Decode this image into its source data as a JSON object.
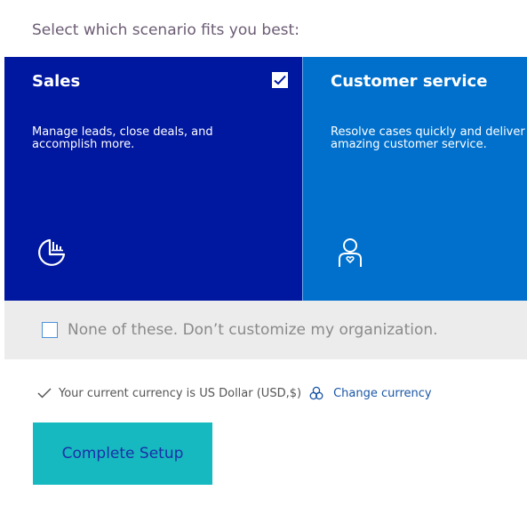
{
  "prompt": "Select which scenario fits you best:",
  "scenarios": [
    {
      "title": "Sales",
      "description": "Manage leads, close deals, and\naccomplish more.",
      "icon": "sales-chart-icon",
      "selected": true,
      "color": "#0017a0"
    },
    {
      "title": "Customer service",
      "description": "Resolve cases quickly and deliver\namazing customer service.",
      "icon": "customer-service-person-icon",
      "selected": false,
      "color": "#0070cc"
    }
  ],
  "none_option": {
    "label": "None of these. Don’t customize my organization.",
    "checked": false
  },
  "currency": {
    "text": "Your current currency is US Dollar (USD,$)",
    "change_label": "Change currency",
    "status_icon": "checkmark-icon",
    "link_icon": "globe-icon"
  },
  "complete_button": {
    "label": "Complete Setup",
    "color": "#16b9c0"
  }
}
